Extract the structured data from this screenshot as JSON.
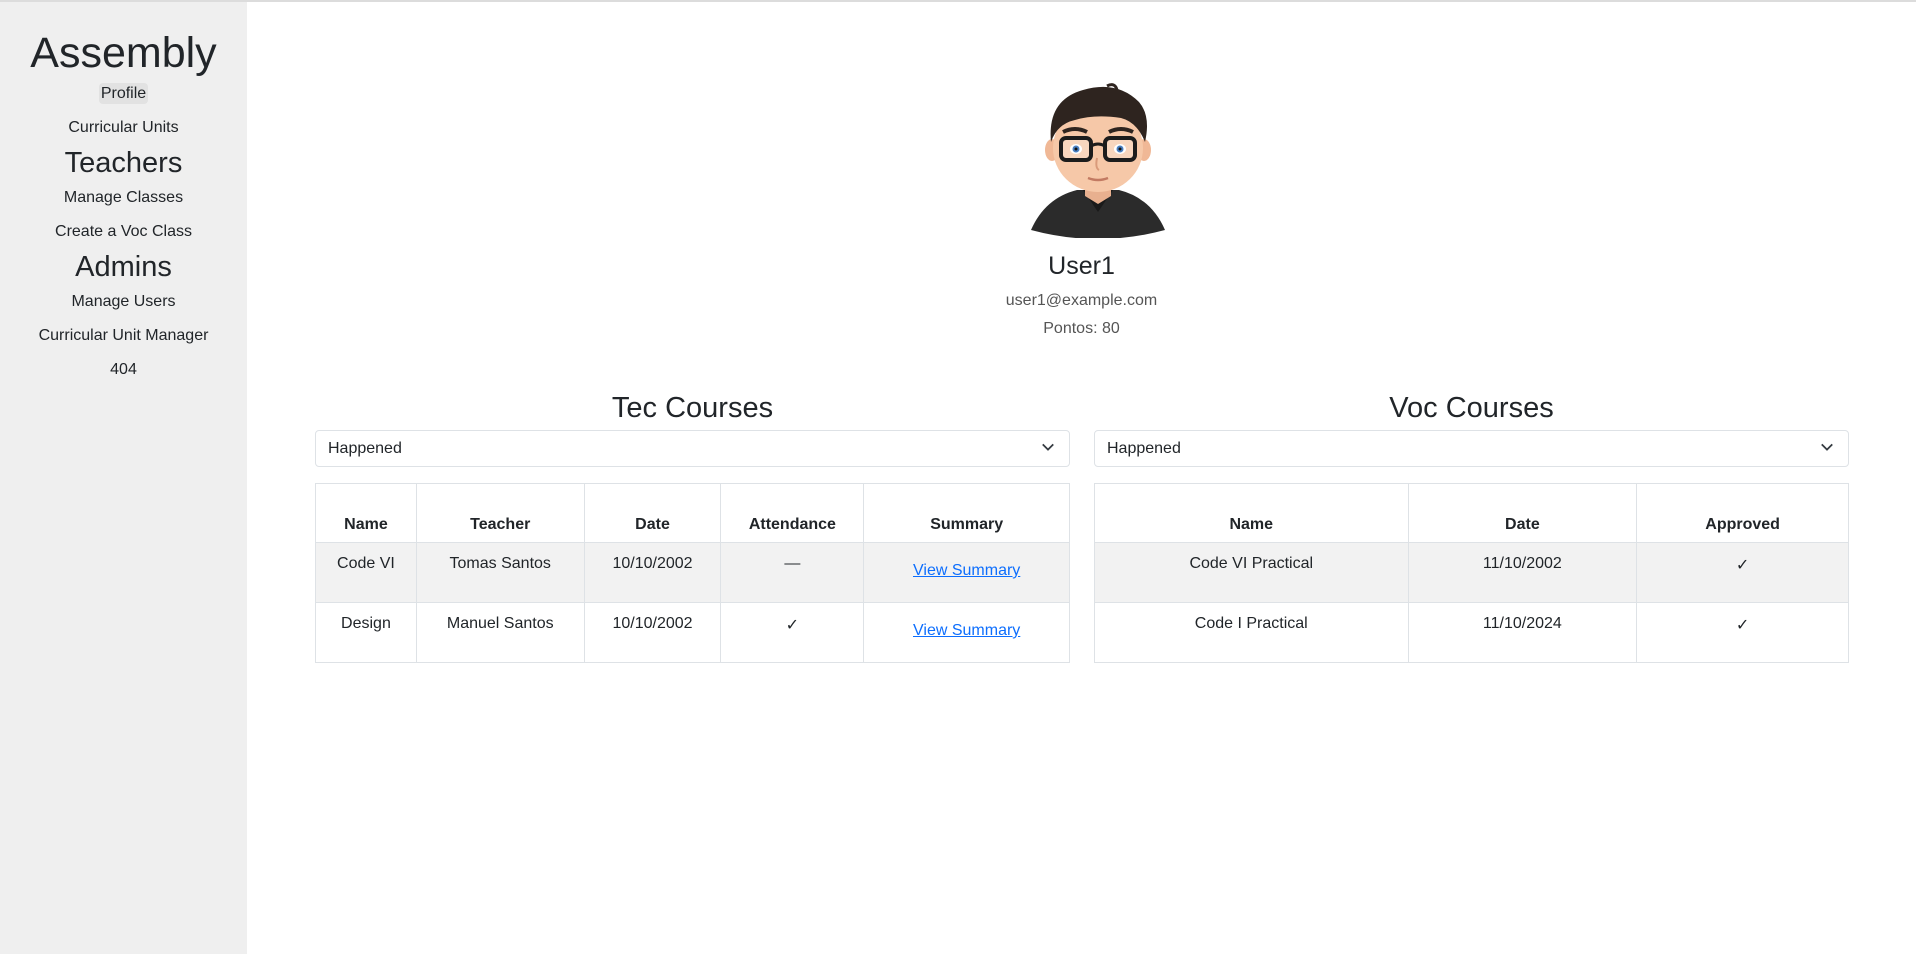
{
  "sidebar": {
    "brand": "Assembly",
    "items_main": [
      {
        "label": "Profile"
      },
      {
        "label": "Curricular Units"
      }
    ],
    "teachers_heading": "Teachers",
    "items_teachers": [
      {
        "label": "Manage Classes"
      },
      {
        "label": "Create a Voc Class"
      }
    ],
    "admins_heading": "Admins",
    "items_admins": [
      {
        "label": "Manage Users"
      },
      {
        "label": "Curricular Unit Manager"
      },
      {
        "label": "404"
      }
    ]
  },
  "profile": {
    "name": "User1",
    "email": "user1@example.com",
    "points": "Pontos: 80"
  },
  "tec": {
    "title": "Tec Courses",
    "filter": "Happened",
    "headers": [
      "Name",
      "Teacher",
      "Date",
      "Attendance",
      "Summary"
    ],
    "rows": [
      {
        "name": "Code VI",
        "teacher": "Tomas Santos",
        "date": "10/10/2002",
        "attendance": "—",
        "summary": "View Summary"
      },
      {
        "name": "Design",
        "teacher": "Manuel Santos",
        "date": "10/10/2002",
        "attendance": "✓",
        "summary": "View Summary"
      }
    ]
  },
  "voc": {
    "title": "Voc Courses",
    "filter": "Happened",
    "headers": [
      "Name",
      "Date",
      "Approved"
    ],
    "rows": [
      {
        "name": "Code VI Practical",
        "date": "11/10/2002",
        "approved": "✓"
      },
      {
        "name": "Code I Practical",
        "date": "11/10/2024",
        "approved": "✓"
      }
    ]
  },
  "colors": {
    "sidebar_bg": "#efefef",
    "link": "#0d6efd",
    "striped_row": "#f2f2f2",
    "border": "#dee2e6"
  },
  "icons": {
    "avatar": "avatar-icon",
    "dropdown": "chevron-down-icon"
  }
}
